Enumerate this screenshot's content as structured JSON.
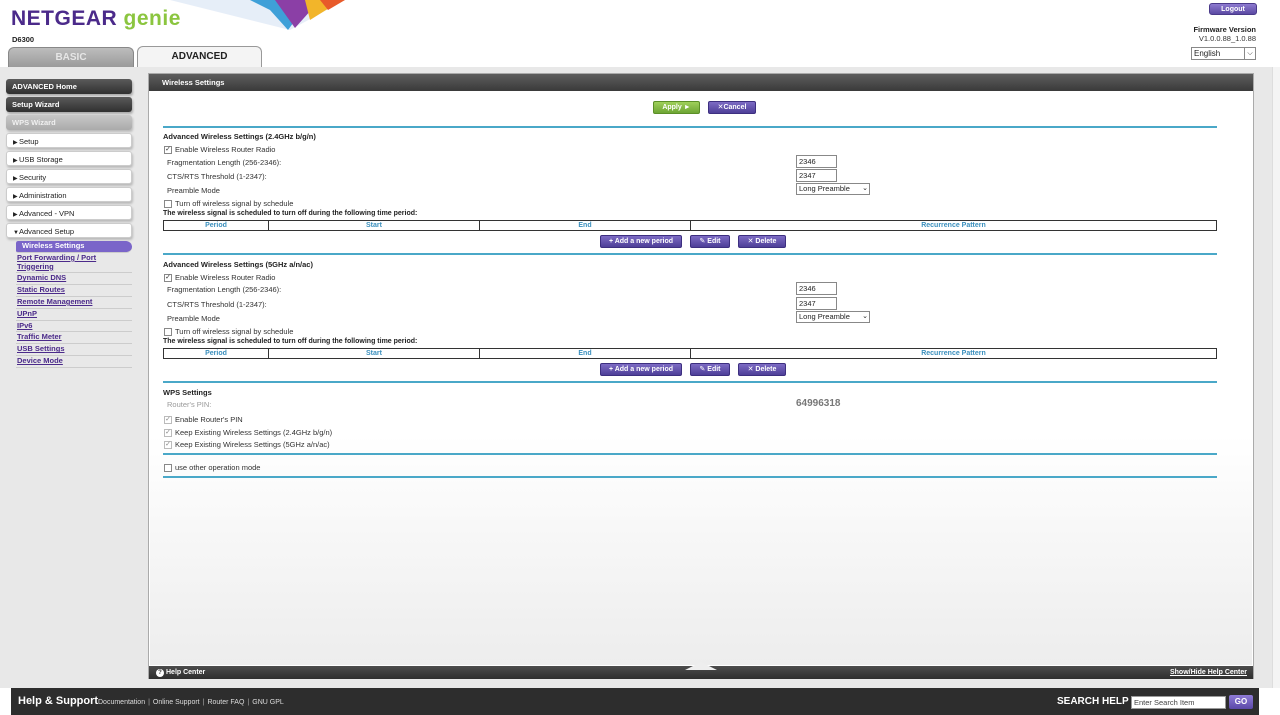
{
  "header": {
    "logo_brand": "NETGEAR",
    "logo_genie": "genie",
    "model": "D6300",
    "tab_basic": "BASIC",
    "tab_advanced": "ADVANCED",
    "logout_label": "Logout",
    "firmware_label": "Firmware Version",
    "firmware_version": "V1.0.0.88_1.0.88",
    "language": "English"
  },
  "sidebar": {
    "advanced_home": "ADVANCED Home",
    "setup_wizard": "Setup Wizard",
    "wps_wizard": "WPS Wizard",
    "setup": "Setup",
    "usb_storage": "USB Storage",
    "security": "Security",
    "administration": "Administration",
    "advanced_vpn": "Advanced - VPN",
    "advanced_setup": "Advanced Setup",
    "sub_items": [
      "Wireless Settings",
      "Port Forwarding / Port Triggering",
      "Dynamic DNS",
      "Static Routes",
      "Remote Management",
      "UPnP",
      "IPv6",
      "Traffic Meter",
      "USB Settings",
      "Device Mode"
    ]
  },
  "panel": {
    "title": "Wireless Settings",
    "apply_label": "Apply ►",
    "cancel_label": "Cancel",
    "help_center": "Help Center",
    "show_hide_help": "Show/Hide Help Center"
  },
  "band24": {
    "title": "Advanced Wireless Settings (2.4GHz b/g/n)",
    "enable_radio": "Enable Wireless Router Radio",
    "frag_label": "Fragmentation Length (256-2346):",
    "frag_value": "2346",
    "rts_label": "CTS/RTS Threshold (1-2347):",
    "rts_value": "2347",
    "preamble_label": "Preamble Mode",
    "preamble_value": "Long Preamble",
    "schedule_label": "Turn off wireless signal by schedule",
    "schedule_note": "The wireless signal is scheduled to turn off during the following time period:",
    "columns": [
      "Period",
      "Start",
      "End",
      "Recurrence Pattern"
    ],
    "add_period": "Add a new period",
    "edit": "Edit",
    "delete": "Delete"
  },
  "band5": {
    "title": "Advanced Wireless Settings (5GHz a/n/ac)",
    "enable_radio": "Enable Wireless Router Radio",
    "frag_label": "Fragmentation Length (256-2346):",
    "frag_value": "2346",
    "rts_label": "CTS/RTS Threshold (1-2347):",
    "rts_value": "2347",
    "preamble_label": "Preamble Mode",
    "preamble_value": "Long Preamble",
    "schedule_label": "Turn off wireless signal by schedule",
    "schedule_note": "The wireless signal is scheduled to turn off during the following time period:",
    "columns": [
      "Period",
      "Start",
      "End",
      "Recurrence Pattern"
    ],
    "add_period": "Add a new period",
    "edit": "Edit",
    "delete": "Delete"
  },
  "wps": {
    "title": "WPS Settings",
    "pin_label": "Router's PIN:",
    "pin_value": "64996318",
    "enable_pin": "Enable Router's PIN",
    "keep_24": "Keep Existing Wireless Settings (2.4GHz b/g/n)",
    "keep_5": "Keep Existing Wireless Settings (5GHz a/n/ac)",
    "other_mode": "use other operation mode"
  },
  "footer": {
    "title": "Help & Support",
    "links": [
      "Documentation",
      "Online Support",
      "Router FAQ",
      "GNU GPL"
    ],
    "search_label": "SEARCH HELP",
    "search_placeholder": "Enter Search Item",
    "go_label": "GO"
  },
  "colors": {
    "accent_purple": "#4b2a8a",
    "accent_green": "#8bc53f",
    "rule_blue": "#4aa8c8"
  }
}
